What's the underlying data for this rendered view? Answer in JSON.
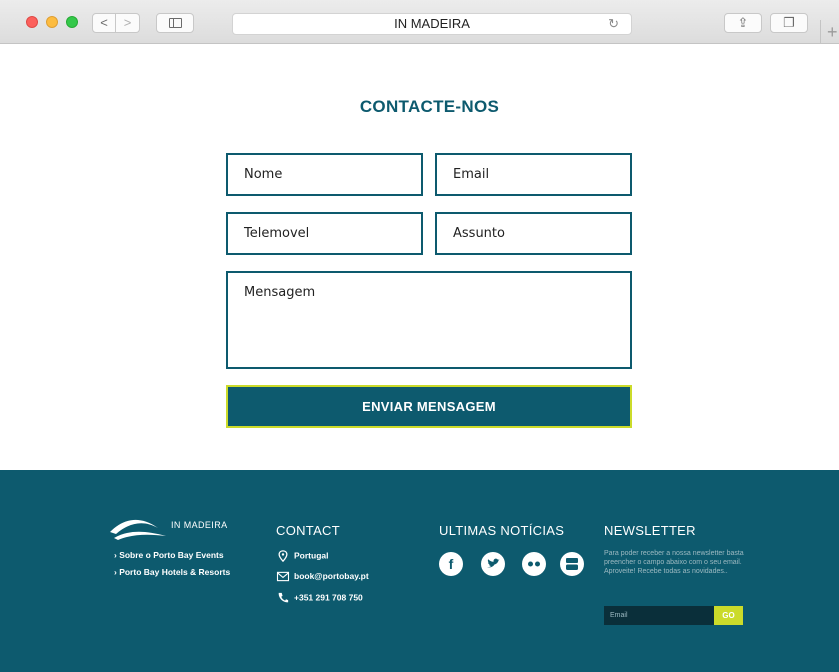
{
  "browser": {
    "url_title": "IN MADEIRA",
    "back_glyph": "<",
    "forward_glyph": ">",
    "reload_glyph": "↻",
    "share_glyph": "⇪",
    "tabs_glyph": "❐",
    "new_tab_glyph": "+"
  },
  "contact_form": {
    "title": "CONTACTE-NOS",
    "fields": {
      "name_placeholder": "Nome",
      "email_placeholder": "Email",
      "phone_placeholder": "Telemovel",
      "subject_placeholder": "Assunto",
      "message_placeholder": "Mensagem"
    },
    "submit_label": "ENVIAR MENSAGEM"
  },
  "footer": {
    "logo_text": "IN MADEIRA",
    "about_links": [
      "› Sobre o Porto Bay Events",
      "› Porto Bay Hotels & Resorts"
    ],
    "contact": {
      "title": "CONTACT",
      "location": "Portugal",
      "email": "book@portobay.pt",
      "phone": "+351 291 708 750"
    },
    "news": {
      "title": "ULTIMAS NOTÍCIAS",
      "social_icons": [
        "facebook-icon",
        "twitter-icon",
        "flickr-icon",
        "youtube-icon"
      ]
    },
    "newsletter": {
      "title": "NEWSLETTER",
      "text": "Para poder receber a nossa newsletter basta preencher o campo abaixo com o seu email. Aproveite! Recebe todas as novidades..",
      "input_placeholder": "Email",
      "button_label": "GO"
    }
  },
  "colors": {
    "brand_teal": "#0d5a6e",
    "accent_lime": "#cbdb2a"
  }
}
